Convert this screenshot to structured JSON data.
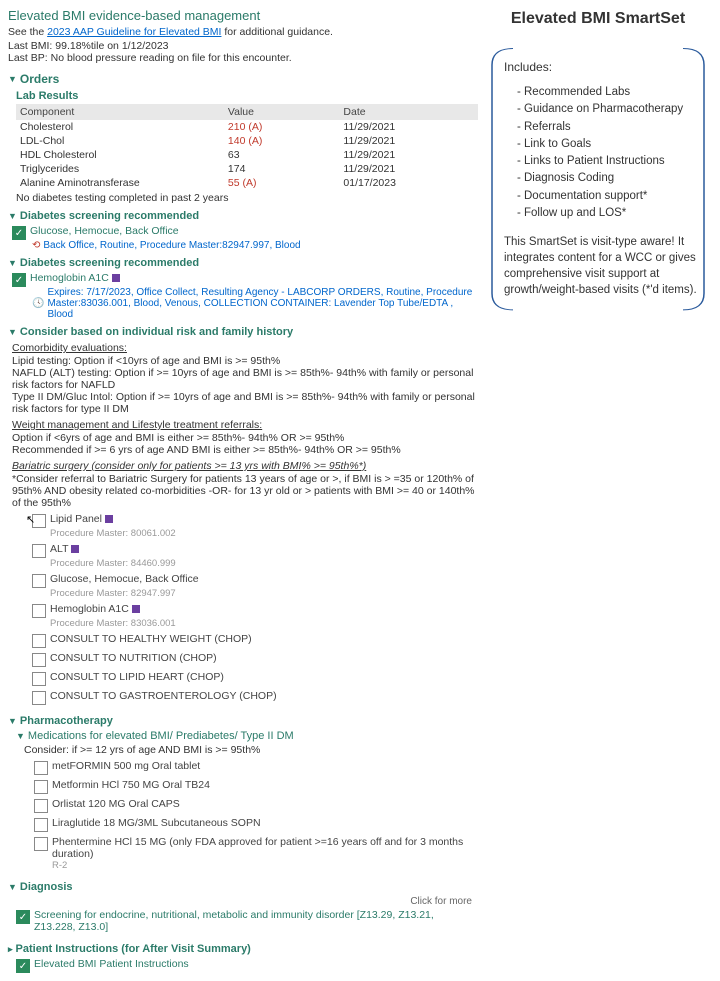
{
  "header": {
    "title": "Elevated BMI evidence-based management",
    "guide_prefix": "See the ",
    "guide_link": "2023 AAP Guideline for Elevated BMI",
    "guide_suffix": " for additional guidance.",
    "last_bmi": "Last BMI: 99.18%tile on 1/12/2023",
    "last_bp": "Last BP: No blood pressure reading on file for this encounter."
  },
  "orders": {
    "header": "Orders",
    "lab_header": "Lab Results",
    "cols": {
      "component": "Component",
      "value": "Value",
      "date": "Date"
    },
    "rows": [
      {
        "c": "Cholesterol",
        "v": "210 (A)",
        "d": "11/29/2021",
        "abn": true
      },
      {
        "c": "LDL-Chol",
        "v": "140 (A)",
        "d": "11/29/2021",
        "abn": true
      },
      {
        "c": "HDL Cholesterol",
        "v": "63",
        "d": "11/29/2021",
        "abn": false
      },
      {
        "c": "Triglycerides",
        "v": "174",
        "d": "11/29/2021",
        "abn": false
      },
      {
        "c": "Alanine Aminotransferase",
        "v": "55 (A)",
        "d": "01/17/2023",
        "abn": true
      }
    ],
    "diabetes_note": "No diabetes testing completed in past 2 years"
  },
  "screen1": {
    "hdr": "Diabetes screening recommended",
    "item": "Glucose, Hemocue, Back Office",
    "detail": "Back Office, Routine, Procedure Master:82947.997, Blood"
  },
  "screen2": {
    "hdr": "Diabetes screening recommended",
    "item": "Hemoglobin A1C",
    "detail": "Expires: 7/17/2023, Office Collect, Resulting Agency - LABCORP ORDERS, Routine, Procedure Master:83036.001, Blood, Venous, COLLECTION CONTAINER: Lavender Top Tube/EDTA , Blood"
  },
  "consider": {
    "hdr": "Consider based on individual risk and family history",
    "comorbid_title": "Comorbidity evaluations:",
    "comorbid_body": "Lipid testing: Option if <10yrs of age and BMI is >= 95th%\nNAFLD (ALT) testing: Option if >= 10yrs of age and BMI is >= 85th%- 94th% with family or personal risk factors for NAFLD\nType II DM/Gluc Intol: Option if >= 10yrs of age and BMI is >= 85th%- 94th% with family or personal risk factors for type II DM",
    "weight_title": "Weight management and Lifestyle treatment referrals:",
    "weight_body": "Option if <6yrs of age and BMI is either >= 85th%- 94th% OR >= 95th%\nRecommended if >= 6 yrs of age AND BMI is either >= 85th%- 94th% OR >= 95th%",
    "bari_title": "Bariatric surgery (consider only for patients >= 13 yrs with BMI% >= 95th%*)",
    "bari_body": "*Consider referral to Bariatric Surgery for patients 13 years of age or >, if BMI is > =35 or 120th% of 95th% AND obesity related co-morbidities -OR- for 13 yr old or > patients with BMI >= 40 or 140th% of the 95th%"
  },
  "order_items": [
    {
      "label": "Lipid Panel",
      "proc": "Procedure Master: 80061.002",
      "swatch": true
    },
    {
      "label": "ALT",
      "proc": "Procedure Master: 84460.999",
      "swatch": true
    },
    {
      "label": "Glucose, Hemocue, Back Office",
      "proc": "Procedure Master: 82947.997",
      "swatch": false
    },
    {
      "label": "Hemoglobin A1C",
      "proc": "Procedure Master: 83036.001",
      "swatch": true
    },
    {
      "label": "CONSULT TO HEALTHY WEIGHT (CHOP)",
      "proc": "",
      "swatch": false
    },
    {
      "label": "CONSULT TO NUTRITION (CHOP)",
      "proc": "",
      "swatch": false
    },
    {
      "label": "CONSULT TO LIPID HEART (CHOP)",
      "proc": "",
      "swatch": false
    },
    {
      "label": "CONSULT TO GASTROENTEROLOGY (CHOP)",
      "proc": "",
      "swatch": false
    }
  ],
  "pharma": {
    "hdr": "Pharmacotherapy",
    "sub": "Medications for elevated BMI/ Prediabetes/ Type II DM",
    "consider": "Consider: if >= 12 yrs of age AND BMI is >= 95th%",
    "meds": [
      "metFORMIN 500 mg Oral tablet",
      "Metformin HCl 750 MG Oral TB24",
      "Orlistat 120 MG Oral CAPS",
      "Liraglutide 18 MG/3ML Subcutaneous SOPN",
      "Phentermine HCl 15 MG (only FDA approved for patient >=16 years off and for 3 months duration)"
    ],
    "r2": "R-2"
  },
  "diagnosis": {
    "hdr": "Diagnosis",
    "click_more": "Click for more",
    "item": "Screening for endocrine, nutritional, metabolic and immunity disorder [Z13.29, Z13.21, Z13.228, Z13.0]"
  },
  "pt_inst": {
    "hdr": "Patient Instructions (for After Visit Summary)",
    "item": "Elevated BMI Patient Instructions"
  },
  "right": {
    "title": "Elevated BMI SmartSet",
    "includes": "Includes:",
    "list": [
      "Recommended Labs",
      "Guidance on Pharmacotherapy",
      "Referrals",
      "Link to Goals",
      "Links to Patient Instructions",
      "Diagnosis Coding",
      "Documentation support*",
      "Follow up and LOS*"
    ],
    "note": "This SmartSet is visit-type aware! It integrates content for a WCC or gives comprehensive visit support at growth/weight-based visits (*'d items)."
  }
}
